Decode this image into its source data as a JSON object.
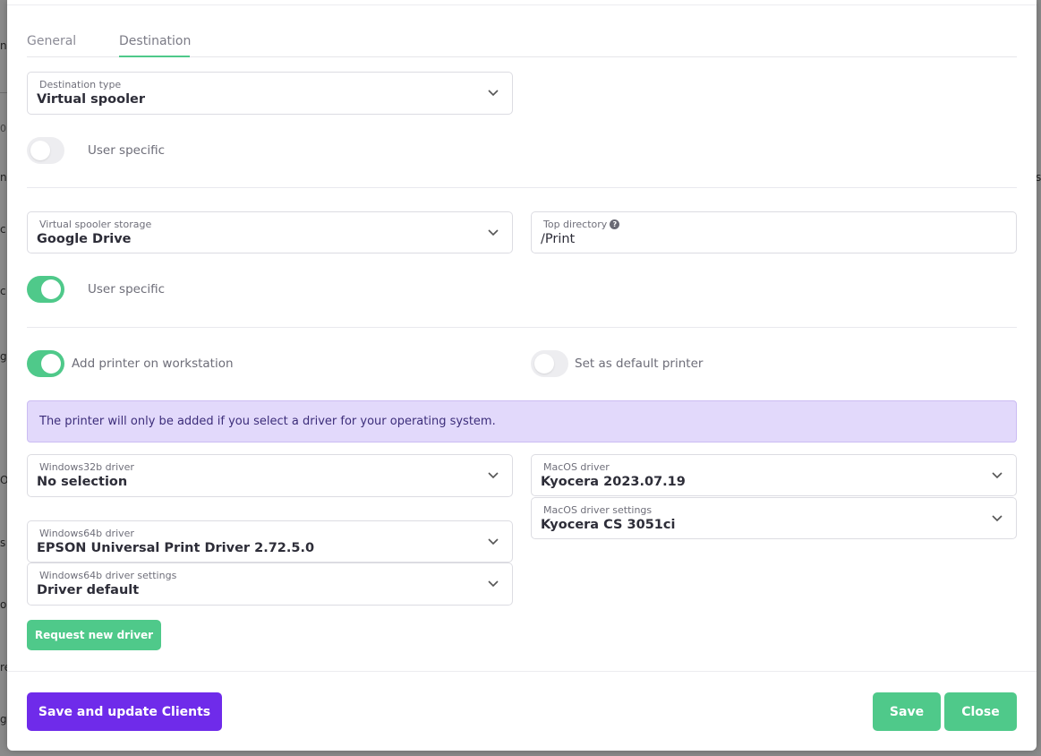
{
  "background": {
    "fragments": [
      "n",
      "0",
      "ne",
      "c",
      "c",
      "g",
      "O",
      "s",
      "ol",
      "re",
      "g"
    ],
    "right_fragments": [
      "s"
    ]
  },
  "tabs": [
    {
      "label": "General"
    },
    {
      "label": "Destination"
    }
  ],
  "destination_type": {
    "label": "Destination type",
    "value": "Virtual spooler"
  },
  "user_specific_1": {
    "label": "User specific",
    "on": false
  },
  "spooler_storage": {
    "label": "Virtual spooler storage",
    "value": "Google Drive"
  },
  "top_directory": {
    "label": "Top directory",
    "value": "/Print",
    "help_icon": "question-circle-icon"
  },
  "user_specific_2": {
    "label": "User specific",
    "on": true
  },
  "add_printer": {
    "label": "Add printer on workstation",
    "on": true
  },
  "default_printer": {
    "label": "Set as default printer",
    "on": false
  },
  "alert": {
    "text": "The printer will only be added if you select a driver for your operating system."
  },
  "win32_driver": {
    "label": "Windows32b driver",
    "value": "No selection"
  },
  "win64_driver": {
    "label": "Windows64b driver",
    "value": "EPSON Universal Print Driver 2.72.5.0"
  },
  "win64_settings": {
    "label": "Windows64b driver settings",
    "value": "Driver default"
  },
  "macos_driver": {
    "label": "MacOS driver",
    "value": "Kyocera 2023.07.19"
  },
  "macos_settings": {
    "label": "MacOS driver settings",
    "value": "Kyocera CS 3051ci"
  },
  "request_driver": {
    "label": "Request new driver"
  },
  "footer": {
    "save_update_label": "Save and update Clients",
    "save_label": "Save",
    "close_label": "Close"
  },
  "colors": {
    "accent_green": "#4fc98a",
    "accent_purple": "#6f2bea",
    "alert_bg": "#e2d9fb"
  }
}
